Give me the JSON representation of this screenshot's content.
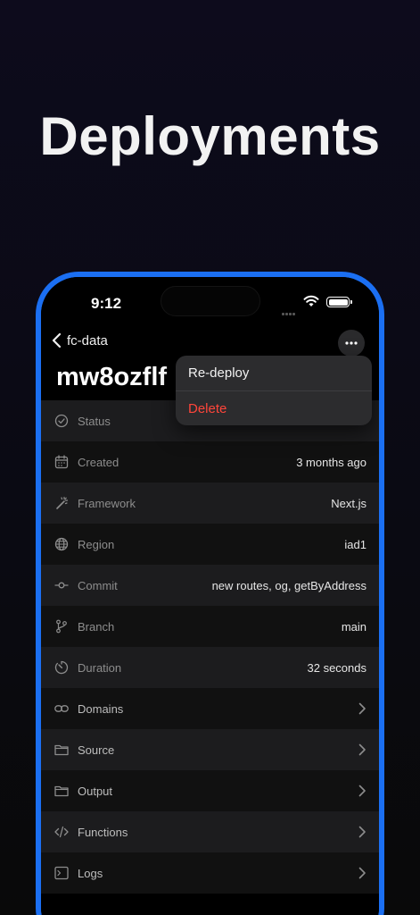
{
  "hero": {
    "title": "Deployments"
  },
  "status_bar": {
    "time": "9:12"
  },
  "nav": {
    "back_label": "fc-data"
  },
  "page": {
    "title": "mw8ozflf"
  },
  "menu": {
    "items": [
      {
        "label": "Re-deploy"
      },
      {
        "label": "Delete"
      }
    ]
  },
  "details": [
    {
      "label": "Status",
      "value": "",
      "icon": "check-circle-icon"
    },
    {
      "label": "Created",
      "value": "3 months ago",
      "icon": "calendar-icon"
    },
    {
      "label": "Framework",
      "value": "Next.js",
      "icon": "magic-wand-icon"
    },
    {
      "label": "Region",
      "value": "iad1",
      "icon": "globe-icon"
    },
    {
      "label": "Commit",
      "value": "new routes, og, getByAddress",
      "icon": "commit-icon"
    },
    {
      "label": "Branch",
      "value": "main",
      "icon": "branch-icon"
    },
    {
      "label": "Duration",
      "value": "32 seconds",
      "icon": "timer-icon"
    },
    {
      "label": "Domains",
      "icon": "link-icon"
    },
    {
      "label": "Source",
      "icon": "folder-icon"
    },
    {
      "label": "Output",
      "icon": "folder-icon"
    },
    {
      "label": "Functions",
      "icon": "code-icon"
    },
    {
      "label": "Logs",
      "icon": "terminal-icon"
    }
  ],
  "colors": {
    "accent": "#1b6ff2",
    "danger": "#ff453a"
  }
}
